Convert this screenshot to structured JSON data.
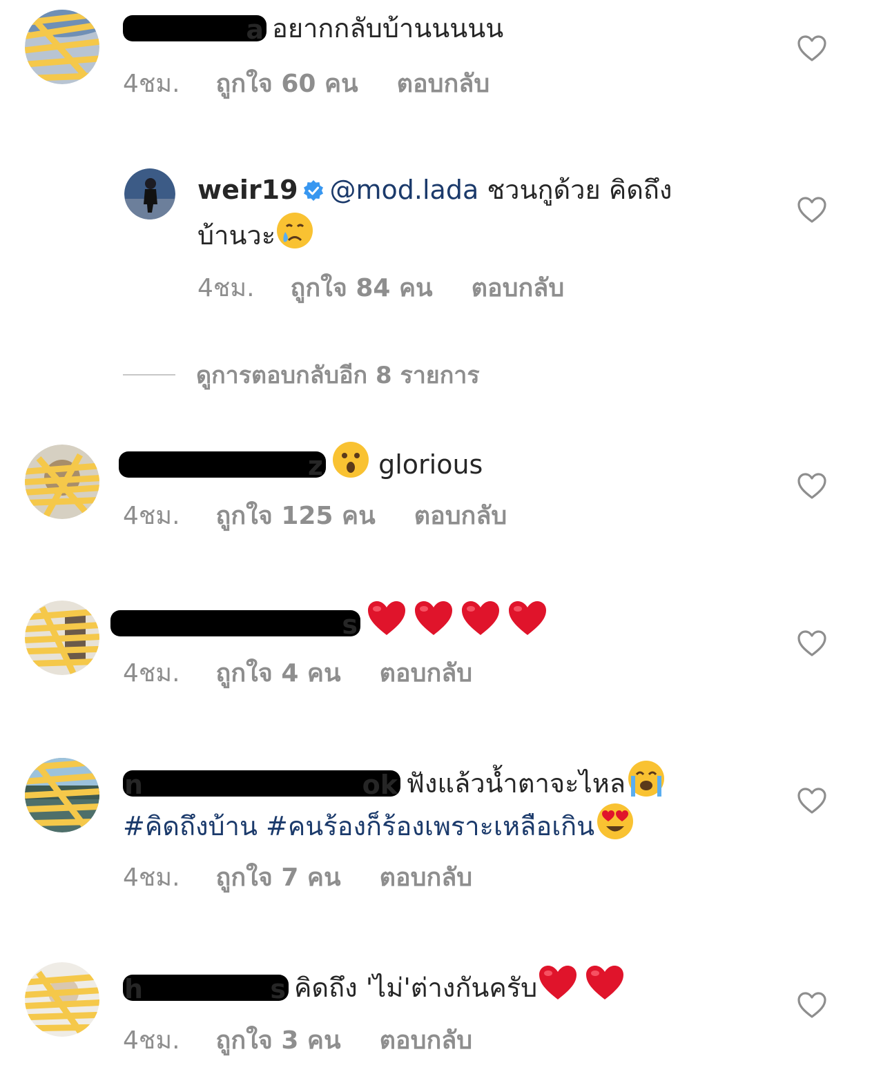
{
  "colors": {
    "meta_gray": "#8e8e8e",
    "link_blue": "#1b3a6b",
    "verified_blue": "#3897f0",
    "heart_red": "#e0142b"
  },
  "comments": [
    {
      "username_fragment": "a",
      "text": "อยากกลับบ้านนนนน",
      "time": "4ชม.",
      "likes": "ถูกใจ 60 คน",
      "reply": "ตอบกลับ"
    },
    {
      "username": "weir19",
      "mention": "@mod.lada",
      "text_line1": "ชวนกูด้วย คิดถึง",
      "text_line2": "บ้านวะ",
      "emoji": "crying-face",
      "time": "4ชม.",
      "likes": "ถูกใจ 84 คน",
      "reply": "ตอบกลับ"
    },
    {
      "username_fragment": "z",
      "emoji": "hushed-face",
      "text": "glorious",
      "time": "4ชม.",
      "likes": "ถูกใจ 125 คน",
      "reply": "ตอบกลับ"
    },
    {
      "username_fragment": "s",
      "emojis": [
        "red-heart",
        "red-heart",
        "red-heart",
        "red-heart"
      ],
      "time": "4ชม.",
      "likes": "ถูกใจ 4 คน",
      "reply": "ตอบกลับ"
    },
    {
      "username_fragment_start": "n",
      "username_fragment": "ok",
      "text": "ฟังแล้วน้ำตาจะไหล",
      "emoji": "loudly-crying-face",
      "hashtag1": "#คิดถึงบ้าน",
      "hashtag2": "#คนร้องก็ร้องเพราะเหลือเกิน",
      "emoji2": "heart-eyes-face",
      "time": "4ชม.",
      "likes": "ถูกใจ 7 คน",
      "reply": "ตอบกลับ"
    },
    {
      "username_fragment_start": "h",
      "username_fragment": "s",
      "text": "คิดถึง 'ไม่'ต่างกันครับ",
      "emojis": [
        "red-heart",
        "red-heart"
      ],
      "time": "4ชม.",
      "likes": "ถูกใจ 3 คน",
      "reply": "ตอบกลับ"
    }
  ],
  "view_more_replies": "ดูการตอบกลับอีก 8 รายการ",
  "icons": {
    "like": "heart-outline-icon",
    "verified": "verified-badge-icon"
  }
}
